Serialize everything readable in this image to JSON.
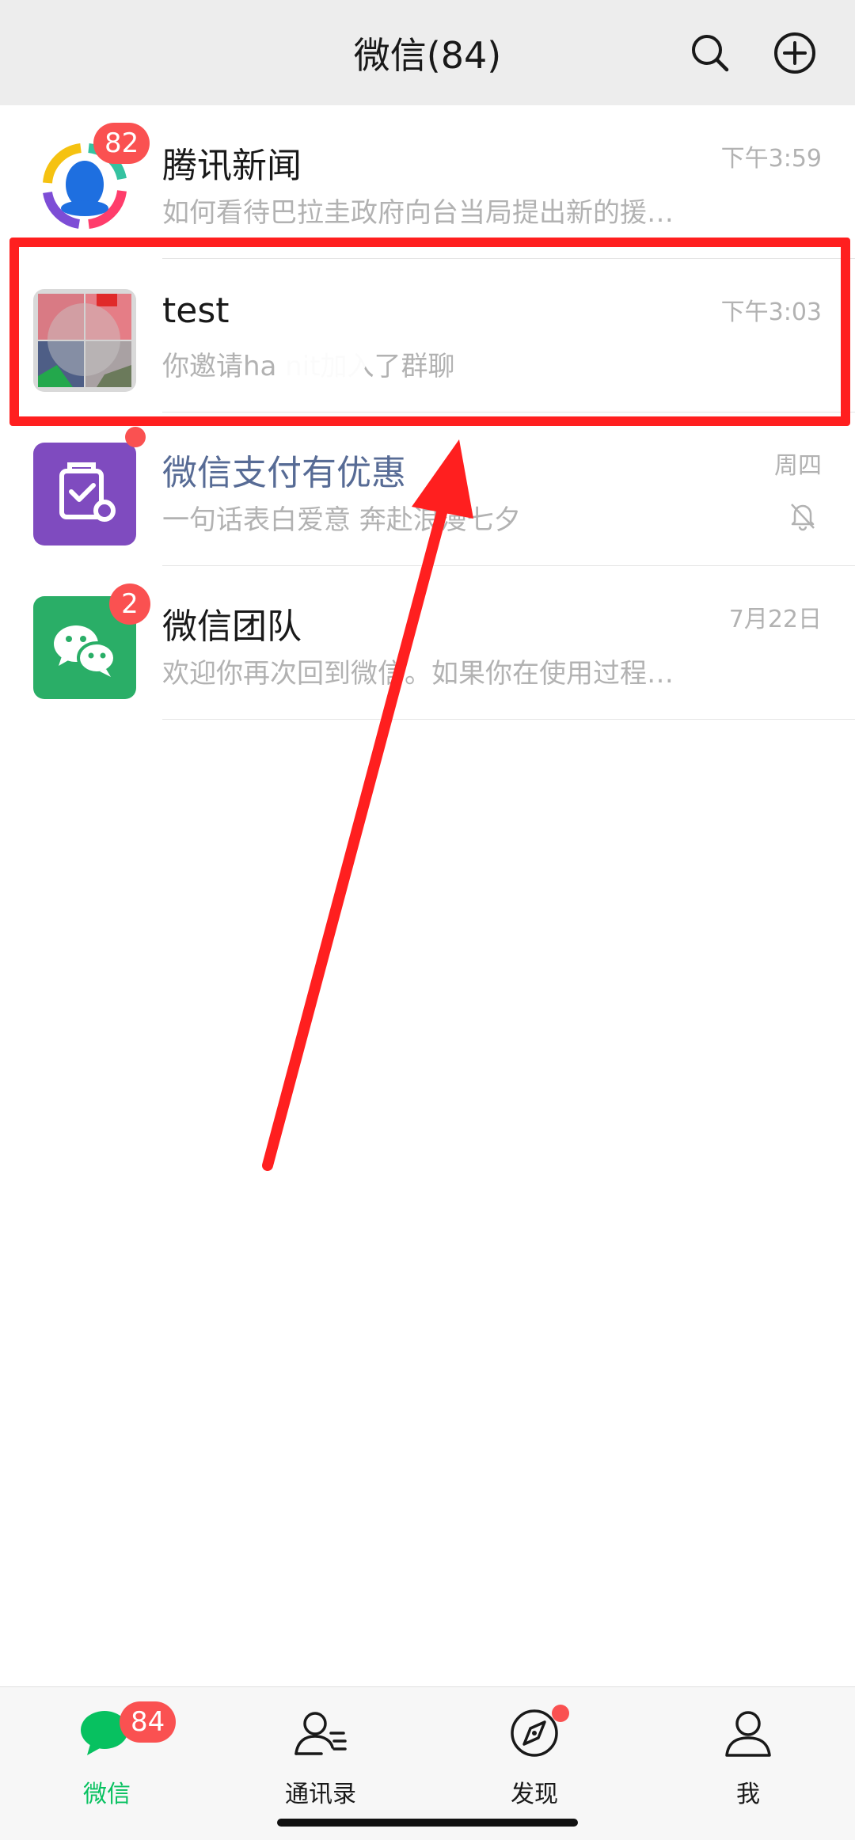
{
  "header": {
    "title": "微信(84)",
    "search_icon": "search-icon",
    "add_icon": "plus-circle-icon"
  },
  "chats": [
    {
      "name": "腾讯新闻",
      "preview": "如何看待巴拉圭政府向台当局提出新的援…",
      "time": "下午3:59",
      "badge": "82",
      "avatar_icon": "tencent-news-penguin-icon"
    },
    {
      "name": "test",
      "preview": "你邀请ha        nit加入了群聊",
      "time": "下午3:03",
      "avatar_icon": "group-grid-avatar"
    },
    {
      "name": "微信支付有优惠",
      "preview": "一句话表白爱意 奔赴浪漫七夕",
      "time": "周四",
      "has_dot": true,
      "muted": true,
      "avatar_icon": "wechat-pay-coupon-icon"
    },
    {
      "name": "微信团队",
      "preview": "欢迎你再次回到微信。如果你在使用过程…",
      "time": "7月22日",
      "badge": "2",
      "avatar_icon": "wechat-logo-icon"
    }
  ],
  "tabs": [
    {
      "label": "微信",
      "icon": "chats-icon",
      "badge": "84",
      "active": true
    },
    {
      "label": "通讯录",
      "icon": "contacts-icon"
    },
    {
      "label": "发现",
      "icon": "discover-compass-icon",
      "has_dot": true
    },
    {
      "label": "我",
      "icon": "me-icon"
    }
  ],
  "colors": {
    "accent_green": "#07c160",
    "badge_red": "#fa5151",
    "annotation_red": "#ff1f1f",
    "service_name_blue": "#576b95",
    "header_bg": "#ededed"
  }
}
